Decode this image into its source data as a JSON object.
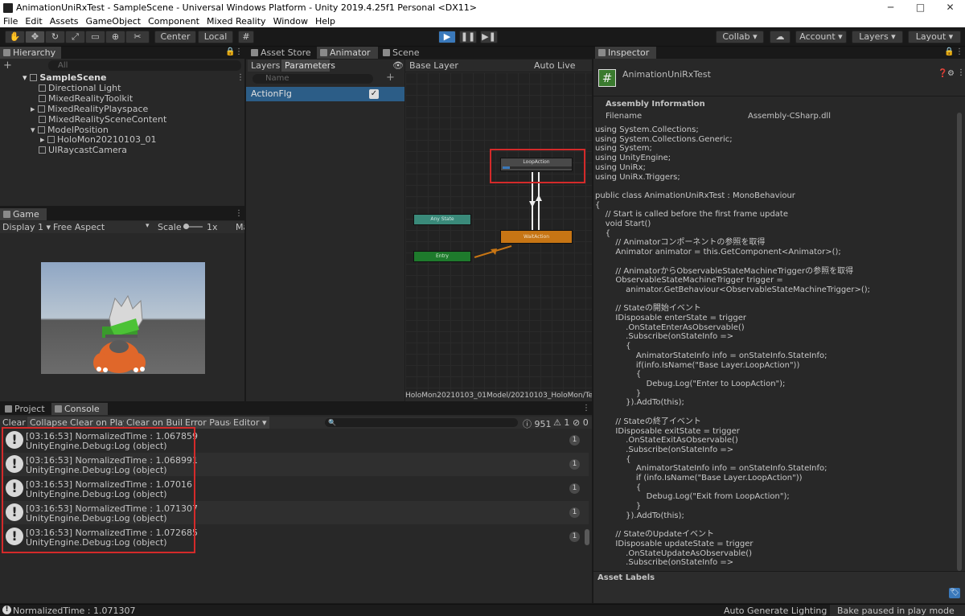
{
  "window": {
    "title": "AnimationUniRxTest - SampleScene - Universal Windows Platform - Unity 2019.4.25f1 Personal <DX11>",
    "min": "─",
    "max": "□",
    "close": "✕"
  },
  "menu": [
    "File",
    "Edit",
    "Assets",
    "GameObject",
    "Component",
    "Mixed Reality",
    "Window",
    "Help"
  ],
  "toolbar": {
    "center": "Center",
    "local": "Local",
    "collab": "Collab",
    "account": "Account",
    "layers": "Layers",
    "layout": "Layout"
  },
  "hierarchy": {
    "tab": "Hierarchy",
    "search_placeholder": "All",
    "add": "+",
    "scene": "SampleScene",
    "items": [
      "Directional Light",
      "MixedRealityToolkit",
      "MixedRealityPlayspace",
      "MixedRealitySceneContent",
      "ModelPosition",
      "HoloMon20210103_01",
      "UIRaycastCamera"
    ]
  },
  "game": {
    "tab": "Game",
    "display": "Display 1",
    "aspect": "Free Aspect",
    "scale_label": "Scale",
    "scale_value": "1x",
    "trailing": "Ma"
  },
  "animator": {
    "tabs": [
      "Asset Store",
      "Animator",
      "Scene"
    ],
    "sub_tabs": [
      "Layers",
      "Parameters"
    ],
    "search_placeholder": "Name",
    "add": "+",
    "param_name": "ActionFlg",
    "base_layer": "Base Layer",
    "auto_live_link": "Auto Live Link",
    "states": {
      "loop": "LoopAction",
      "wait": "WaitAction",
      "any": "Any State",
      "entry": "Entry"
    },
    "footer_path": "HoloMon20210103_01Model/20210103_HoloMon/TestAnima"
  },
  "inspector": {
    "tab": "Inspector",
    "script_name": "AnimationUniRxTest",
    "assembly_info": "Assembly Information",
    "filename_label": "Filename",
    "filename_value": "Assembly-CSharp.dll",
    "asset_labels": "Asset Labels",
    "code": "using System.Collections;\nusing System.Collections.Generic;\nusing System;\nusing UnityEngine;\nusing UniRx;\nusing UniRx.Triggers;\n\npublic class AnimationUniRxTest : MonoBehaviour\n{\n    // Start is called before the first frame update\n    void Start()\n    {\n        // Animatorコンポーネントの参照を取得\n        Animator animator = this.GetComponent<Animator>();\n\n        // AnimatorからObservableStateMachineTriggerの参照を取得\n        ObservableStateMachineTrigger trigger =\n            animator.GetBehaviour<ObservableStateMachineTrigger>();\n\n        // Stateの開始イベント\n        IDisposable enterState = trigger\n            .OnStateEnterAsObservable()\n            .Subscribe(onStateInfo =>\n            {\n                AnimatorStateInfo info = onStateInfo.StateInfo;\n                if(info.IsName(\"Base Layer.LoopAction\"))\n                {\n                    Debug.Log(\"Enter to LoopAction\");\n                }\n            }).AddTo(this);\n\n        // Stateの終了イベント\n        IDisposable exitState = trigger\n            .OnStateExitAsObservable()\n            .Subscribe(onStateInfo =>\n            {\n                AnimatorStateInfo info = onStateInfo.StateInfo;\n                if (info.IsName(\"Base Layer.LoopAction\"))\n                {\n                    Debug.Log(\"Exit from LoopAction\");\n                }\n            }).AddTo(this);\n\n        // StateのUpdateイベント\n        IDisposable updateState = trigger\n            .OnStateUpdateAsObservable()\n            .Subscribe(onStateInfo =>"
  },
  "console": {
    "tabs": [
      "Project",
      "Console"
    ],
    "buttons": [
      "Clear",
      "Collapse",
      "Clear on Play",
      "Clear on Build",
      "Error Pause",
      "Editor"
    ],
    "counts": {
      "info": "951",
      "warn": "1",
      "error": "0"
    },
    "rows": [
      {
        "line1": "[03:16:53] NormalizedTime : 1.067859",
        "line2": "UnityEngine.Debug:Log (object)",
        "count": "1"
      },
      {
        "line1": "[03:16:53] NormalizedTime : 1.068991",
        "line2": "UnityEngine.Debug:Log (object)",
        "count": "1"
      },
      {
        "line1": "[03:16:53] NormalizedTime : 1.07016",
        "line2": "UnityEngine.Debug:Log (object)",
        "count": "1"
      },
      {
        "line1": "[03:16:53] NormalizedTime : 1.071307",
        "line2": "UnityEngine.Debug:Log (object)",
        "count": "1"
      },
      {
        "line1": "[03:16:53] NormalizedTime : 1.072685",
        "line2": "UnityEngine.Debug:Log (object)",
        "count": "1"
      }
    ]
  },
  "statusbar": {
    "message": "NormalizedTime : 1.071307",
    "lighting": "Auto Generate Lighting Off",
    "bake": "Bake paused in play mode"
  },
  "colors": {
    "accent": "#3a79bb",
    "highlight_box": "#d42a2a",
    "state_orange": "#c77514",
    "state_green": "#1e7a2c",
    "state_teal": "#3a8a7a"
  }
}
